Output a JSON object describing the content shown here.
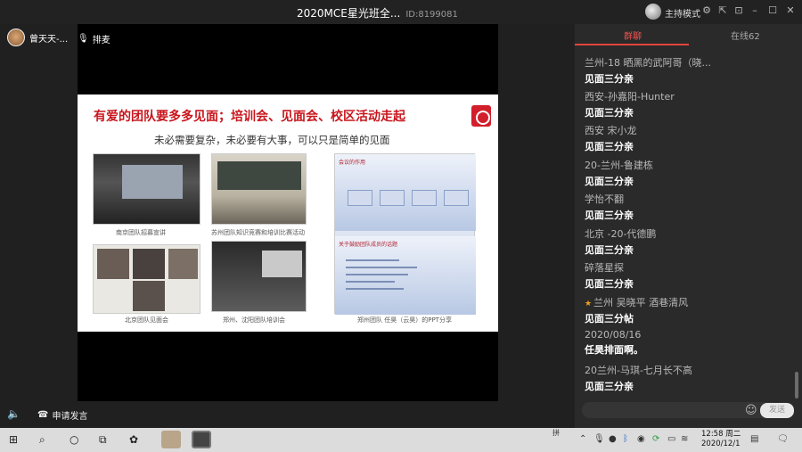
{
  "window": {
    "title": "2020MCE星光班全...",
    "room_id": "ID:8199081",
    "host_mode_label": "主持模式"
  },
  "stage": {
    "user_name": "曾天天-...",
    "queue_label": "排麦",
    "apply_label": "申请发言"
  },
  "slide": {
    "title": "有爱的团队要多多见面；培训会、见面会、校区活动走起",
    "subtitle": "未必需要复杂，未必要有大事，可以只是简单的见面",
    "captions": [
      "南京团队招募宣讲",
      "苏州团队知识竞赛和培训比赛活动",
      "北京团队见面会",
      "郑州、沈阳团队培训会",
      "郑州团队 任昊（云昊）的PPT分享"
    ],
    "panel_headers": [
      "会议的作用",
      "关于鼓励团队成员的话题"
    ]
  },
  "chat": {
    "tab_chat": "群聊",
    "tab_online": "在线62",
    "messages": [
      {
        "who": "兰州-18 晒黑的武阿哥（晓...",
        "text": "见面三分亲"
      },
      {
        "who": "西安-孙嘉阳-Hunter",
        "text": "见面三分亲"
      },
      {
        "who": "西安 宋小龙",
        "text": "见面三分亲"
      },
      {
        "who": "20-兰州-鲁建栋",
        "text": "见面三分亲"
      },
      {
        "who": "学怡不翻",
        "text": "见面三分亲"
      },
      {
        "who": "北京 -20-代德鹏",
        "text": "见面三分亲"
      },
      {
        "who": "碎落星探",
        "text": "见面三分亲"
      },
      {
        "who": "兰州 吴晓平 酒巷清风",
        "text": "见面三分帖"
      },
      {
        "who": "2020/08/16",
        "text": "任昊排面啊。"
      },
      {
        "who": "20兰州-马琪-七月长不高",
        "text": "见面三分亲"
      }
    ],
    "send_label": "发送"
  },
  "taskbar": {
    "time": "12:58 周二",
    "date": "2020/12/1",
    "ime": "拼"
  }
}
